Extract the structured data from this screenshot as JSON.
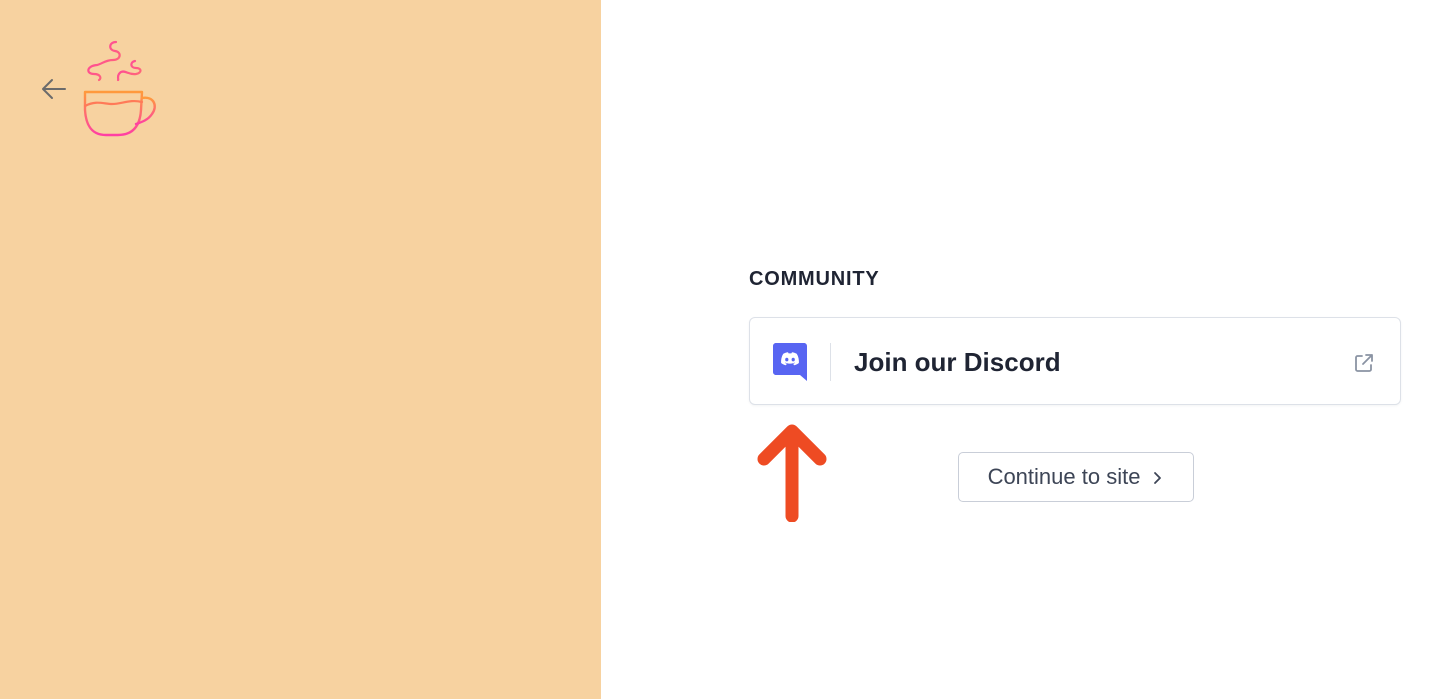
{
  "sidebar": {
    "background": "#f7d2a0",
    "back_icon": "arrow-left-icon",
    "logo_icon": "coffee-cup-icon",
    "logo_colors": [
      "#ff3fa4",
      "#ff9a3c"
    ]
  },
  "community": {
    "heading": "COMMUNITY",
    "discord_card": {
      "label": "Join our Discord",
      "brand_icon": "discord-icon",
      "brand_color": "#5865f2",
      "trailing_icon": "external-link-icon"
    },
    "continue_button": {
      "label": "Continue to site",
      "icon": "chevron-right-icon"
    }
  },
  "annotation": {
    "icon": "arrow-up-icon",
    "color": "#ee4b23"
  }
}
